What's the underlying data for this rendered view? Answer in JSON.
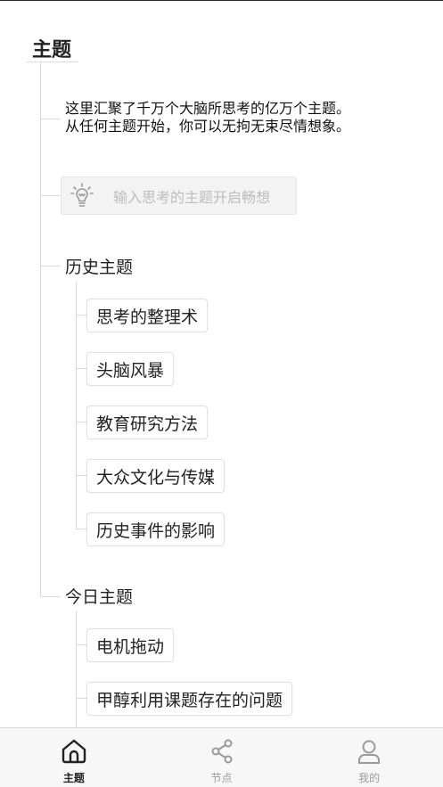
{
  "page": {
    "title": "主题"
  },
  "intro": {
    "line1": "这里汇聚了千万个大脑所思考的亿万个主题。",
    "line2": "从任何主题开始，你可以无拘无束尽情想象。"
  },
  "search": {
    "placeholder": "输入思考的主题开启畅想",
    "icon": "lightbulb-icon"
  },
  "history": {
    "title": "历史主题",
    "items": [
      "思考的整理术",
      "头脑风暴",
      "教育研究方法",
      "大众文化与传媒",
      "历史事件的影响"
    ]
  },
  "today": {
    "title": "今日主题",
    "items": [
      "电机拖动",
      "甲醇利用课题存在的问题"
    ]
  },
  "tabbar": {
    "tabs": [
      {
        "label": "主题",
        "icon": "home-icon",
        "active": true
      },
      {
        "label": "节点",
        "icon": "share-nodes-icon",
        "active": false
      },
      {
        "label": "我的",
        "icon": "user-icon",
        "active": false
      }
    ]
  },
  "colors": {
    "text": "#222222",
    "line": "#d9d9d9",
    "placeholder": "#bdbdbd",
    "tab_inactive": "#9a9a9a"
  }
}
